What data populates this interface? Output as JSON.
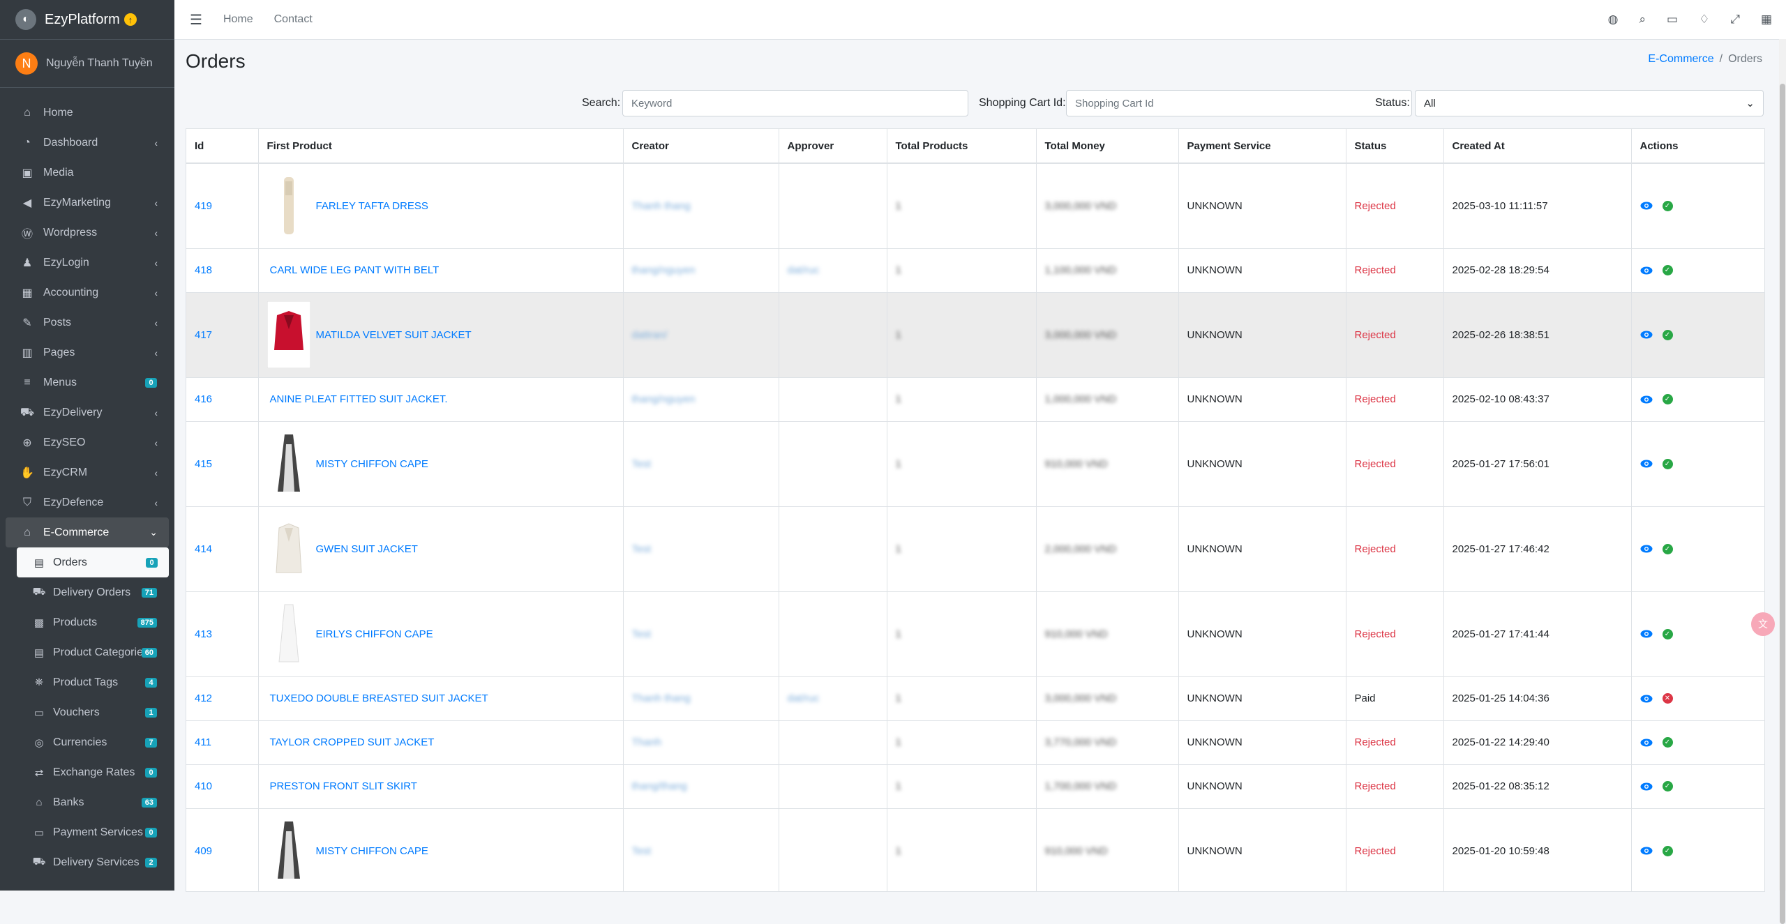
{
  "brand": {
    "name": "EzyPlatform"
  },
  "user": {
    "initial": "N",
    "name": "Nguyễn Thanh Tuyền"
  },
  "sidebar": {
    "items": [
      {
        "label": "Home",
        "icon": "home-icon"
      },
      {
        "label": "Dashboard",
        "icon": "dashboard-icon"
      },
      {
        "label": "Media",
        "icon": "image-icon"
      },
      {
        "label": "EzyMarketing",
        "icon": "megaphone-icon"
      },
      {
        "label": "Wordpress",
        "icon": "wordpress-icon"
      },
      {
        "label": "EzyLogin",
        "icon": "user-lock-icon"
      },
      {
        "label": "Accounting",
        "icon": "calculator-icon"
      },
      {
        "label": "Posts",
        "icon": "pen-icon"
      },
      {
        "label": "Pages",
        "icon": "columns-icon"
      },
      {
        "label": "Menus",
        "icon": "bars-icon",
        "badge": "0"
      },
      {
        "label": "EzyDelivery",
        "icon": "truck-icon"
      },
      {
        "label": "EzySEO",
        "icon": "search-plus-icon"
      },
      {
        "label": "EzyCRM",
        "icon": "handshake-icon"
      },
      {
        "label": "EzyDefence",
        "icon": "shield-icon"
      },
      {
        "label": "E-Commerce",
        "icon": "shop-icon"
      }
    ],
    "sub_items": [
      {
        "label": "Orders",
        "badge": "0"
      },
      {
        "label": "Delivery Orders",
        "badge": "71"
      },
      {
        "label": "Products",
        "badge": "875"
      },
      {
        "label": "Product Categories",
        "badge": "60"
      },
      {
        "label": "Product Tags",
        "badge": "4"
      },
      {
        "label": "Vouchers",
        "badge": "1"
      },
      {
        "label": "Currencies",
        "badge": "7"
      },
      {
        "label": "Exchange Rates",
        "badge": "0"
      },
      {
        "label": "Banks",
        "badge": "63"
      },
      {
        "label": "Payment Services",
        "badge": "0"
      },
      {
        "label": "Delivery Services",
        "badge": "2"
      }
    ]
  },
  "topbar": {
    "home": "Home",
    "contact": "Contact"
  },
  "page": {
    "title": "Orders"
  },
  "breadcrumb": {
    "parent": "E-Commerce",
    "sep": "/",
    "current": "Orders"
  },
  "filters": {
    "search_label": "Search:",
    "search_placeholder": "Keyword",
    "cart_label": "Shopping Cart Id:",
    "cart_placeholder": "Shopping Cart Id",
    "status_label": "Status:",
    "status_value": "All"
  },
  "table": {
    "headers": [
      "Id",
      "First Product",
      "Creator",
      "Approver",
      "Total Products",
      "Total Money",
      "Payment Service",
      "Status",
      "Created At",
      "Actions"
    ],
    "rows": [
      {
        "id": "419",
        "product": "FARLEY TAFTA DRESS",
        "creator": "Thanh thang",
        "approver": "",
        "total_products": "1",
        "total_money": "3,000,000 VND",
        "payment": "UNKNOWN",
        "status": "Rejected",
        "created": "2025-03-10 11:11:57"
      },
      {
        "id": "418",
        "product": "CARL WIDE LEG PANT WITH BELT",
        "creator": "thang/nguyen",
        "approver": "dat/ruc",
        "total_products": "1",
        "total_money": "1,100,000 VND",
        "payment": "UNKNOWN",
        "status": "Rejected",
        "created": "2025-02-28 18:29:54"
      },
      {
        "id": "417",
        "product": "MATILDA VELVET SUIT JACKET",
        "creator": "dattran/",
        "approver": "",
        "total_products": "1",
        "total_money": "3,000,000 VND",
        "payment": "UNKNOWN",
        "status": "Rejected",
        "created": "2025-02-26 18:38:51"
      },
      {
        "id": "416",
        "product": "ANINE PLEAT FITTED SUIT JACKET.",
        "creator": "thang/nguyen",
        "approver": "",
        "total_products": "1",
        "total_money": "1,000,000 VND",
        "payment": "UNKNOWN",
        "status": "Rejected",
        "created": "2025-02-10 08:43:37"
      },
      {
        "id": "415",
        "product": "MISTY CHIFFON CAPE",
        "creator": "Test",
        "approver": "",
        "total_products": "1",
        "total_money": "910,000 VND",
        "payment": "UNKNOWN",
        "status": "Rejected",
        "created": "2025-01-27 17:56:01"
      },
      {
        "id": "414",
        "product": "GWEN SUIT JACKET",
        "creator": "Test",
        "approver": "",
        "total_products": "1",
        "total_money": "2,000,000 VND",
        "payment": "UNKNOWN",
        "status": "Rejected",
        "created": "2025-01-27 17:46:42"
      },
      {
        "id": "413",
        "product": "EIRLYS CHIFFON CAPE",
        "creator": "Test",
        "approver": "",
        "total_products": "1",
        "total_money": "910,000 VND",
        "payment": "UNKNOWN",
        "status": "Rejected",
        "created": "2025-01-27 17:41:44"
      },
      {
        "id": "412",
        "product": "TUXEDO DOUBLE BREASTED SUIT JACKET",
        "creator": "Thanh thang",
        "approver": "dat/ruc",
        "total_products": "1",
        "total_money": "3,000,000 VND",
        "payment": "UNKNOWN",
        "status": "Paid",
        "created": "2025-01-25 14:04:36"
      },
      {
        "id": "411",
        "product": "TAYLOR CROPPED SUIT JACKET",
        "creator": "Thanh",
        "approver": "",
        "total_products": "1",
        "total_money": "3,770,000 VND",
        "payment": "UNKNOWN",
        "status": "Rejected",
        "created": "2025-01-22 14:29:40"
      },
      {
        "id": "410",
        "product": "PRESTON FRONT SLIT SKIRT",
        "creator": "thang/thang",
        "approver": "",
        "total_products": "1",
        "total_money": "1,700,000 VND",
        "payment": "UNKNOWN",
        "status": "Rejected",
        "created": "2025-01-22 08:35:12"
      },
      {
        "id": "409",
        "product": "MISTY CHIFFON CAPE",
        "creator": "Test",
        "approver": "",
        "total_products": "1",
        "total_money": "910,000 VND",
        "payment": "UNKNOWN",
        "status": "Rejected",
        "created": "2025-01-20 10:59:48"
      }
    ]
  },
  "colors": {
    "sidebar": "#343a40",
    "link": "#007bff",
    "rejected": "#dc3545",
    "ok": "#28a745"
  }
}
